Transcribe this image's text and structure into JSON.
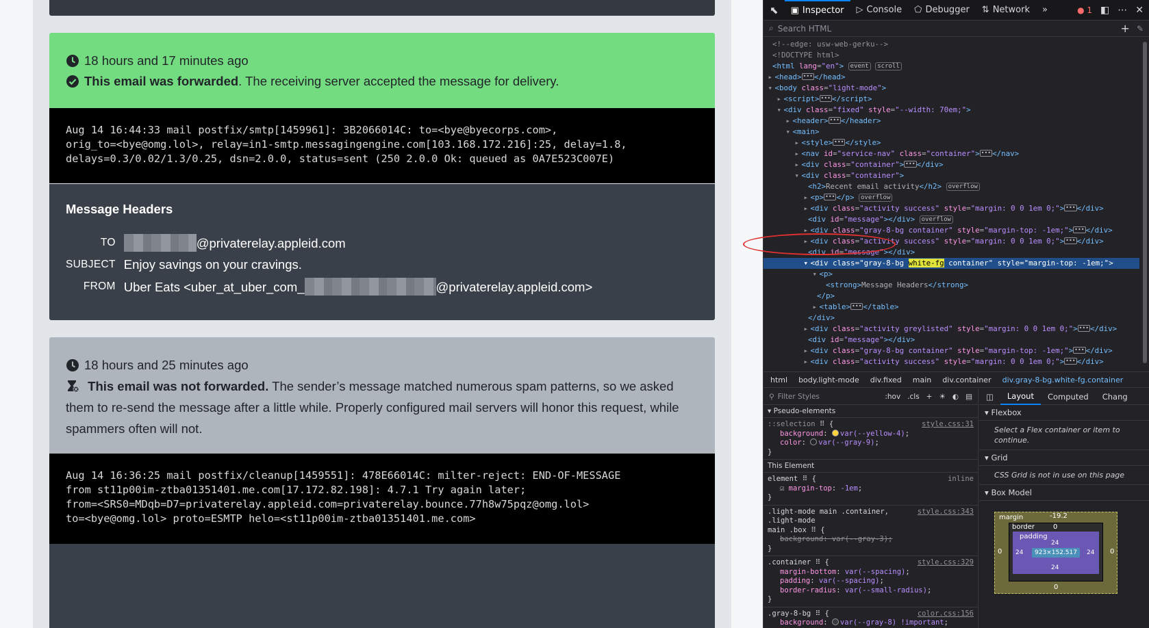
{
  "activity1": {
    "time": "18 hours and 17 minutes ago",
    "status_bold": "This email was forwarded",
    "status_rest": ". The receiving server accepted the message for delivery.",
    "log": "Aug 14 16:44:33 mail postfix/smtp[1459961]: 3B2066014C: to=<bye@byecorps.com>,\norig_to=<bye@omg.lol>, relay=in1-smtp.messagingengine.com[103.168.172.216]:25, delay=1.8,\ndelays=0.3/0.02/1.3/0.25, dsn=2.0.0, status=sent (250 2.0.0 Ok: queued as 0A7E523C007E)"
  },
  "headers": {
    "title": "Message Headers",
    "to_label": "TO",
    "to_value": "@privaterelay.appleid.com",
    "subject_label": "SUBJECT",
    "subject_value": "Enjoy savings on your cravings.",
    "from_label": "FROM",
    "from_prefix": "Uber Eats <uber_at_uber_com_",
    "from_suffix": "@privaterelay.appleid.com>"
  },
  "activity2": {
    "time": "18 hours and 25 minutes ago",
    "status_bold": "This email was not forwarded.",
    "status_rest": " The sender’s message matched numerous spam patterns, so we asked them to re-send the message after a little while. Properly configured mail servers will honor this request, while spammers often will not.",
    "log": "Aug 14 16:36:25 mail postfix/cleanup[1459551]: 478E66014C: milter-reject: END-OF-MESSAGE\nfrom st11p00im-ztba01351401.me.com[17.172.82.198]: 4.7.1 Try again later;\nfrom=<SRS0=MDqb=D7=privaterelay.appleid.com=privaterelay.bounce.77h8w75pqz@omg.lol>\nto=<bye@omg.lol> proto=ESMTP helo=<st11p00im-ztba01351401.me.com>"
  },
  "devtools": {
    "tabs": [
      "Inspector",
      "Console",
      "Debugger",
      "Network"
    ],
    "error_count": "1",
    "search_placeholder": "Search HTML",
    "crumbs": [
      "html",
      "body.light-mode",
      "div.fixed",
      "main",
      "div.container",
      "div.gray-8-bg.white-fg.container"
    ],
    "filter_placeholder": "Filter Styles",
    "filter_opts": [
      ":hov",
      ".cls"
    ],
    "layout_tabs": [
      "Layout",
      "Computed",
      "Chang"
    ],
    "sections": {
      "pseudo": "Pseudo-elements",
      "this_element": "This Element",
      "flexbox": "Flexbox",
      "flex_note": "Select a Flex container or item to continue.",
      "grid": "Grid",
      "grid_note": "CSS Grid is not in use on this page",
      "box_model": "Box Model"
    },
    "box_model": {
      "margin_label": "margin",
      "border_label": "border",
      "padding_label": "padding",
      "margin_top": "-19.2",
      "margin_side": "0",
      "margin_bottom": "0",
      "border_val": "0",
      "padding_val": "24",
      "content": "923×152.517"
    }
  },
  "colors": {
    "success": "#74dc80",
    "greylisted": "#aeb5bd",
    "dark": "#3a4049",
    "selection": "#204e8a"
  }
}
